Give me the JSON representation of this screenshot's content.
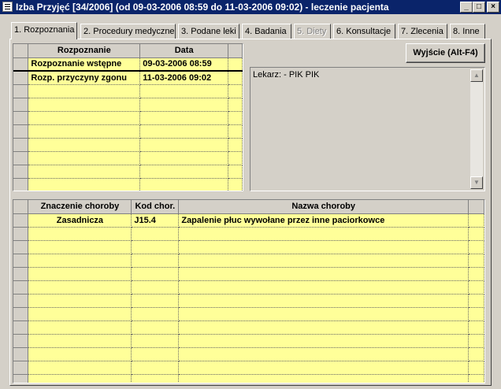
{
  "window": {
    "title": "Izba Przyjęć [34/2006]  (od 09-03-2006 08:59 do 11-03-2006 09:02) - leczenie pacjenta",
    "minimize": "_",
    "maximize": "□",
    "close": "×"
  },
  "tabs": [
    {
      "label": "1. Rozpoznania"
    },
    {
      "label": "2. Procedury medyczne"
    },
    {
      "label": "3. Podane leki"
    },
    {
      "label": "4. Badania"
    },
    {
      "label": "5. Diety"
    },
    {
      "label": "6. Konsultacje"
    },
    {
      "label": "7. Zlecenia"
    },
    {
      "label": "8. Inne"
    }
  ],
  "exit_button": "Wyjście (Alt-F4)",
  "diagnosis_table": {
    "headers": [
      "Rozpoznanie",
      "Data"
    ],
    "rows": [
      [
        "Rozpoznanie wstępne",
        "09-03-2006 08:59"
      ],
      [
        "Rozp. przyczyny zgonu",
        "11-03-2006 09:02"
      ]
    ]
  },
  "memo": {
    "text": "Lekarz: - PIK PIK"
  },
  "disease_table": {
    "headers": [
      "Znaczenie choroby",
      "Kod chor.",
      "Nazwa choroby"
    ],
    "rows": [
      [
        "Zasadnicza",
        "J15.4",
        "Zapalenie płuc wywołane przez inne paciorkowce"
      ]
    ]
  }
}
